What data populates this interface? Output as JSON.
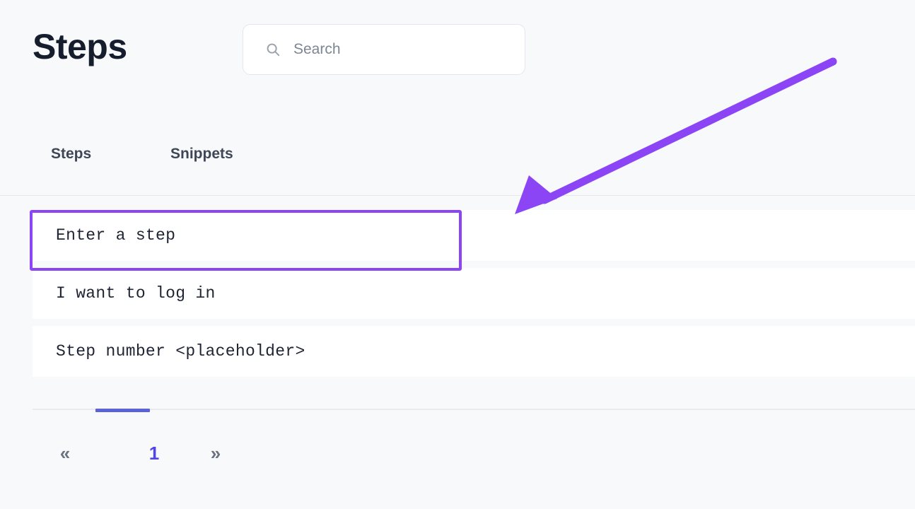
{
  "header": {
    "title": "Steps",
    "search": {
      "placeholder": "Search",
      "value": "",
      "icon": "search-icon"
    }
  },
  "tabs": [
    {
      "label": "Steps",
      "active": true
    },
    {
      "label": "Snippets",
      "active": false
    }
  ],
  "list": {
    "rows": [
      {
        "text": "Enter a step",
        "highlighted": true
      },
      {
        "text": "I want to log in",
        "highlighted": false
      },
      {
        "text": "Step number <placeholder>",
        "highlighted": false
      }
    ]
  },
  "pagination": {
    "prev_label": "«",
    "next_label": "»",
    "current_page": "1"
  },
  "annotation": {
    "arrow": {
      "icon": "arrow-pointing-down-left-icon",
      "color": "#8b45f5",
      "target": "Enter a step"
    },
    "highlight": {
      "color": "#8b45f5",
      "target": "Enter a step"
    }
  },
  "colors": {
    "page_background": "#f8f9fb",
    "row_background": "#ffffff",
    "title_text": "#161e2e",
    "tab_text": "#3f4656",
    "row_text": "#1e2433",
    "placeholder_text": "#7d8693",
    "accent_purple": "#8b45f5",
    "accent_indigo": "#4f46e5",
    "pager_bar": "#5b62d6",
    "divider": "#e5e8ed"
  }
}
